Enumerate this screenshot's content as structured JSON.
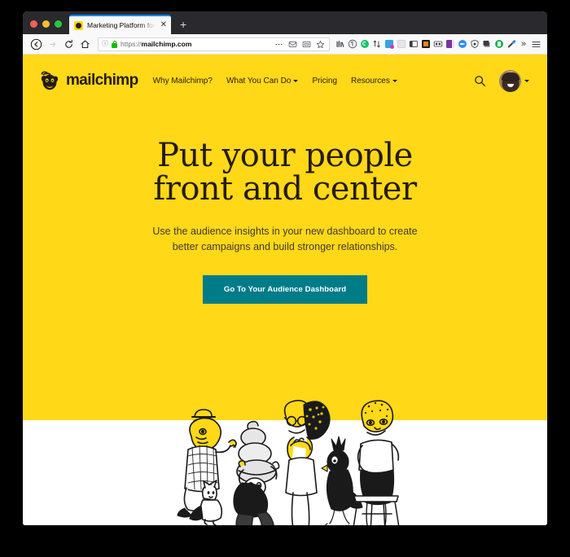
{
  "browser": {
    "traffic_lights": [
      "close",
      "minimize",
      "maximize"
    ],
    "tab": {
      "title": "Marketing Platform for Small B…",
      "favicon": "mailchimp-favicon",
      "close_label": "✕"
    },
    "new_tab_label": "+",
    "nav": {
      "back_label": "←",
      "forward_label": "→",
      "reload_label": "⟳",
      "home_label": "⌂"
    },
    "url_bar": {
      "identity_label": "ⓘ",
      "lock": "secure-lock",
      "scheme": "https://",
      "host": "mailchimp.com",
      "actions": [
        "page-actions-ellipsis",
        "reader-view",
        "screenshot",
        "bookmark-star"
      ]
    },
    "extensions": [
      "library-icon",
      "pocket-icon",
      "grammarly-icon",
      "sync-icon",
      "lastpass-icon",
      "notes-icon",
      "sidebar-icon",
      "container-icon",
      "screenshot-icon",
      "onenote-icon",
      "zoom-icon",
      "privacy-icon",
      "archive-icon",
      "evernote-icon",
      "eyedropper-icon"
    ],
    "overflow_label": "»",
    "menu_label": "☰"
  },
  "site": {
    "logo_text": "mailchimp",
    "nav_items": [
      {
        "label": "Why Mailchimp?",
        "has_caret": false
      },
      {
        "label": "What You Can Do",
        "has_caret": true
      },
      {
        "label": "Pricing",
        "has_caret": false
      },
      {
        "label": "Resources",
        "has_caret": true
      }
    ],
    "search_icon": "search-icon",
    "account_caret": "chevron-down-icon"
  },
  "hero": {
    "headline_line1": "Put your people",
    "headline_line2": "front and center",
    "subhead": "Use the audience insights in your new dashboard to create better campaigns and build stronger relationships.",
    "cta_label": "Go To Your Audience Dashboard",
    "illustration_alt": "group-of-people-with-cat-and-bird-illustration"
  },
  "colors": {
    "brand_yellow": "#FFD818",
    "ink": "#241C15",
    "cta_teal": "#007C89",
    "page_white": "#FFFFFF"
  }
}
